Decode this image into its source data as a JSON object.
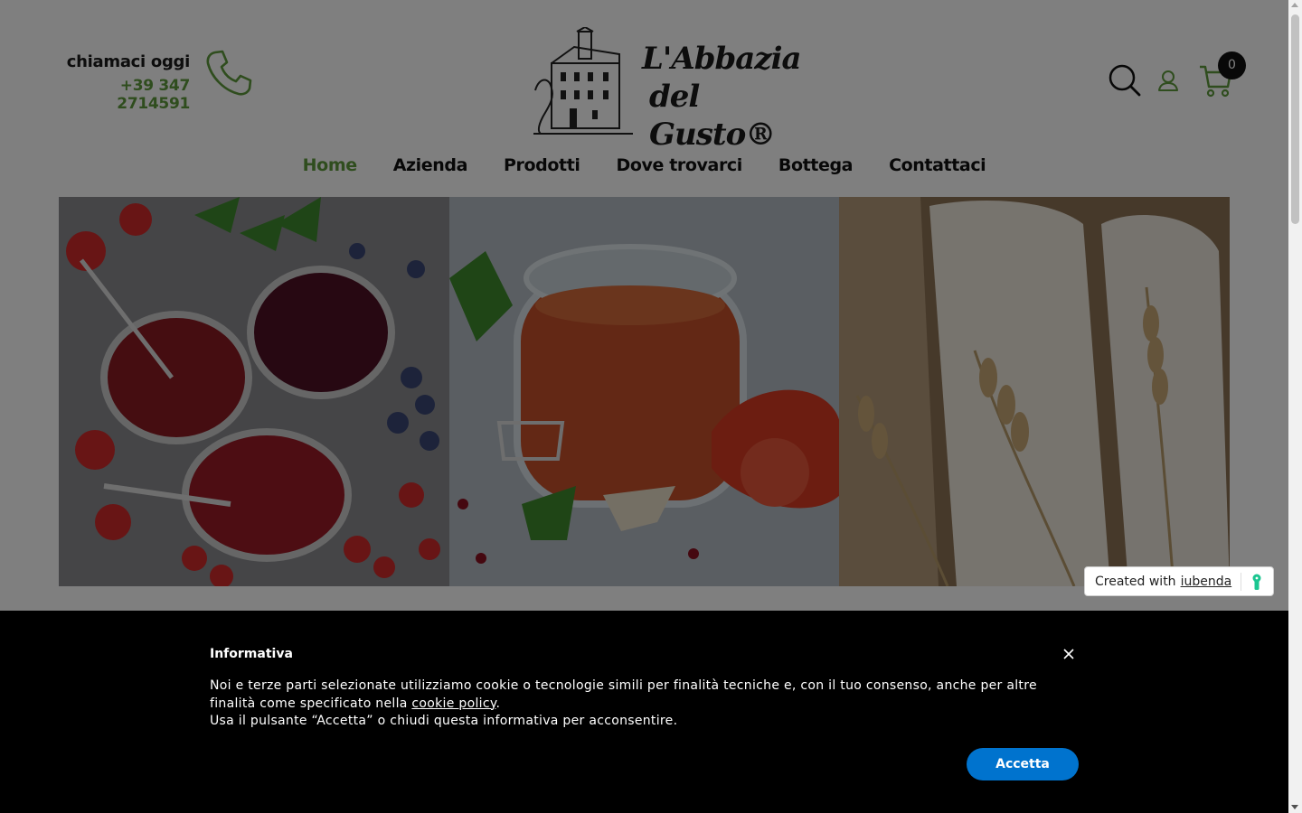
{
  "header": {
    "contact_label": "chiamaci oggi",
    "contact_phone": "+39 347 2714591",
    "logo_line1": "L'Abbazia",
    "logo_line2": "del Gusto®",
    "cart_count": "0"
  },
  "nav": {
    "items": [
      {
        "label": "Home",
        "active": true
      },
      {
        "label": "Azienda"
      },
      {
        "label": "Prodotti"
      },
      {
        "label": "Dove trovarci"
      },
      {
        "label": "Bottega"
      },
      {
        "label": "Contattaci"
      }
    ]
  },
  "hero": {
    "tiles": [
      "berry-jam-image",
      "tomato-sauce-jar-image",
      "flour-wheat-image"
    ]
  },
  "iubenda": {
    "prefix": "Created with",
    "link": "iubenda"
  },
  "cookie_banner": {
    "title": "Informativa",
    "text_part1": "Noi e terze parti selezionate utilizziamo cookie o tecnologie simili per finalità tecniche e, con il tuo consenso, anche per altre finalità come specificato nella ",
    "policy_link": "cookie policy",
    "text_part2": ".",
    "text_line2": "Usa il pulsante “Accetta” o chiudi questa informativa per acconsentire.",
    "accept_label": "Accetta"
  },
  "colors": {
    "accent_green": "#5f9a3c",
    "accept_blue": "#0073ce"
  }
}
